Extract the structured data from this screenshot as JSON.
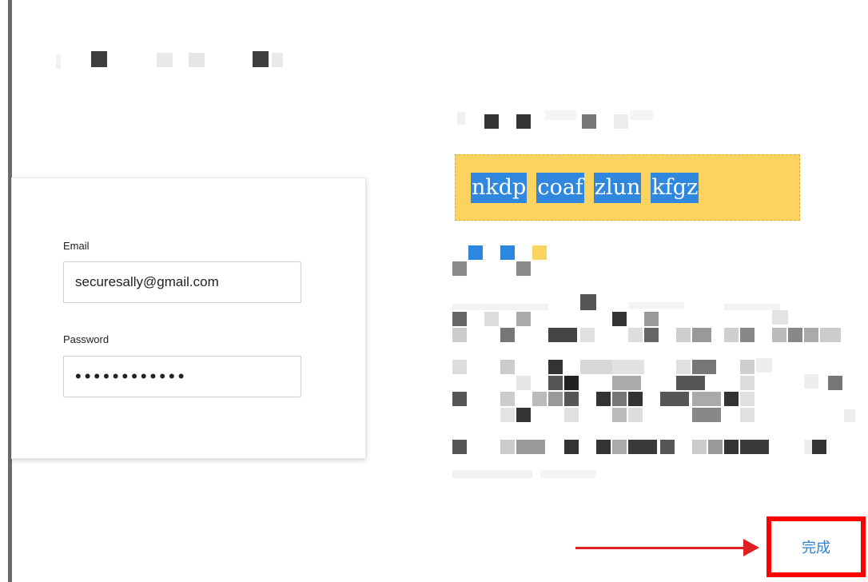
{
  "login": {
    "email_label": "Email",
    "email_value": "securesally@gmail.com",
    "password_label": "Password",
    "password_value": "••••••••••••"
  },
  "recovery": {
    "key_words": [
      "nkdp",
      "coaf",
      "zlun",
      "kfgz"
    ]
  },
  "actions": {
    "done_label": "完成"
  },
  "colors": {
    "banner": "#fbd361",
    "highlight": "#2f87de",
    "annotation": "#ff0000",
    "link": "#2f80d6"
  }
}
